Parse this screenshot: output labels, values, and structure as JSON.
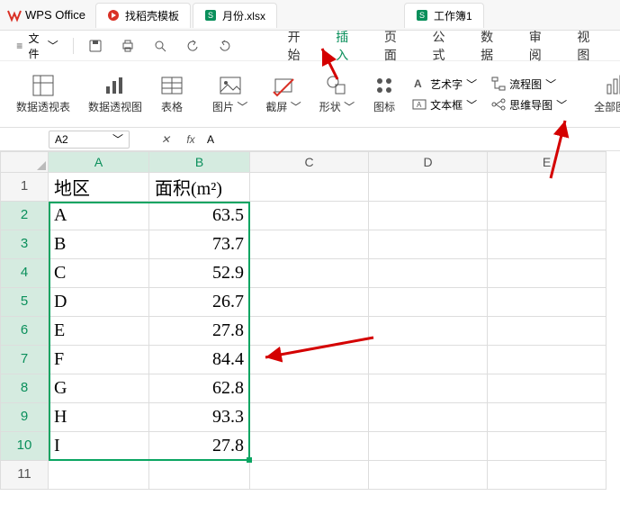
{
  "app": {
    "name": "WPS Office"
  },
  "tabs": [
    {
      "label": "找稻壳模板"
    },
    {
      "label": "月份.xlsx"
    },
    {
      "label": "工作簿1"
    }
  ],
  "menu": {
    "file": "文件",
    "items": [
      "开始",
      "插入",
      "页面",
      "公式",
      "数据",
      "审阅",
      "视图"
    ],
    "active_index": 1
  },
  "ribbon": {
    "pivot_table": "数据透视表",
    "pivot_chart": "数据透视图",
    "table": "表格",
    "picture": "图片",
    "screenshot": "截屏",
    "shapes": "形状",
    "icons": "图标",
    "wordart": "艺术字",
    "flowchart": "流程图",
    "textbox": "文本框",
    "mindmap": "思维导图",
    "all_charts": "全部图表"
  },
  "name_box": "A2",
  "formula_value": "A",
  "sheet": {
    "columns": [
      "A",
      "B",
      "C",
      "D",
      "E"
    ],
    "row_numbers": [
      1,
      2,
      3,
      4,
      5,
      6,
      7,
      8,
      9,
      10,
      11
    ],
    "headers": {
      "col_a": "地区",
      "col_b": "面积(m²)"
    },
    "rows": [
      {
        "region": "A",
        "area": "63.5"
      },
      {
        "region": "B",
        "area": "73.7"
      },
      {
        "region": "C",
        "area": "52.9"
      },
      {
        "region": "D",
        "area": "26.7"
      },
      {
        "region": "E",
        "area": "27.8"
      },
      {
        "region": "F",
        "area": "84.4"
      },
      {
        "region": "G",
        "area": "62.8"
      },
      {
        "region": "H",
        "area": "93.3"
      },
      {
        "region": "I",
        "area": "27.8"
      }
    ]
  }
}
